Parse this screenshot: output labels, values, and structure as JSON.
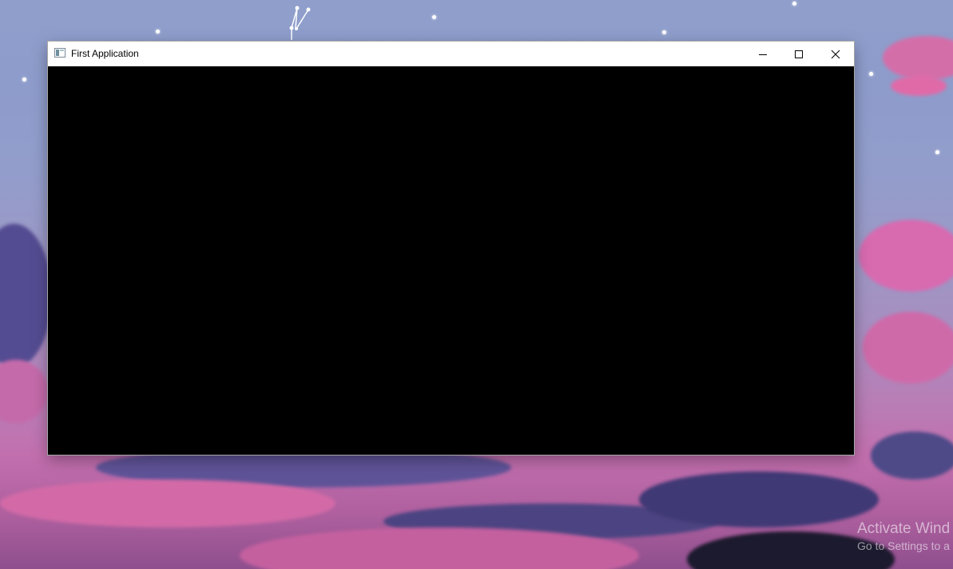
{
  "window": {
    "title": "First Application",
    "app_icon": "window-icon",
    "controls": {
      "minimize": "minimize-icon",
      "maximize": "maximize-icon",
      "close": "close-icon"
    },
    "client_background": "#000000"
  },
  "desktop": {
    "wallpaper": "pink-purple-sky-with-clouds",
    "watermark": {
      "title": "Activate Wind",
      "subtitle": "Go to Settings to a"
    }
  },
  "colors": {
    "titlebar": "#ffffff",
    "sky": "#8f9ecb",
    "pink_cloud": "#d966a8",
    "purple_cloud": "#5d4e93"
  }
}
